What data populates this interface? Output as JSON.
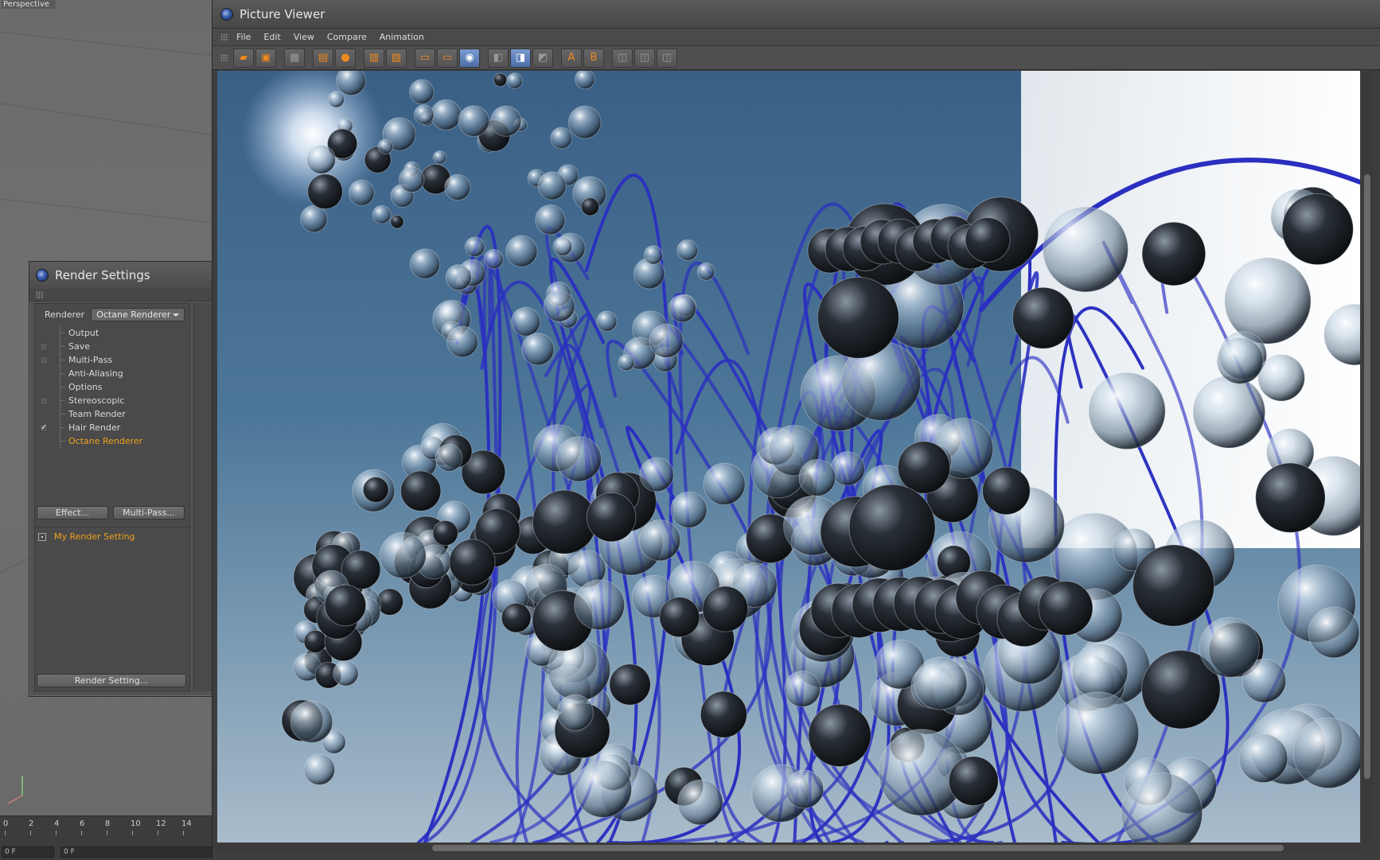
{
  "viewport": {
    "label": "Perspective"
  },
  "timeline": {
    "ticks": [
      "0",
      "2",
      "4",
      "6",
      "8",
      "10",
      "12",
      "14"
    ],
    "current_frame": "0 F",
    "start_frame": "0 F"
  },
  "render_settings": {
    "title": "Render Settings",
    "renderer_label": "Renderer",
    "renderer_value": "Octane Renderer",
    "items": [
      {
        "label": "Output",
        "check": "none"
      },
      {
        "label": "Save",
        "check": "off"
      },
      {
        "label": "Multi-Pass",
        "check": "off"
      },
      {
        "label": "Anti-Aliasing",
        "check": "none"
      },
      {
        "label": "Options",
        "check": "none"
      },
      {
        "label": "Stereoscopic",
        "check": "off"
      },
      {
        "label": "Team Render",
        "check": "none"
      },
      {
        "label": "Hair Render",
        "check": "on"
      },
      {
        "label": "Octane Renderer",
        "check": "none",
        "selected": true
      }
    ],
    "effect_button": "Effect...",
    "multipass_button": "Multi-Pass...",
    "setting_name": "My Render Setting",
    "render_setting_button": "Render Setting...",
    "check_mark": "✓"
  },
  "picture_viewer": {
    "title": "Picture Viewer",
    "menu": [
      "File",
      "Edit",
      "View",
      "Compare",
      "Animation"
    ],
    "toolbar_labels": {
      "compare_a": "A",
      "compare_b": "B"
    }
  },
  "colors": {
    "selected_text": "#f0a020",
    "hair_strands": "#2a2fc0",
    "sky_top": "#3a5f85"
  }
}
